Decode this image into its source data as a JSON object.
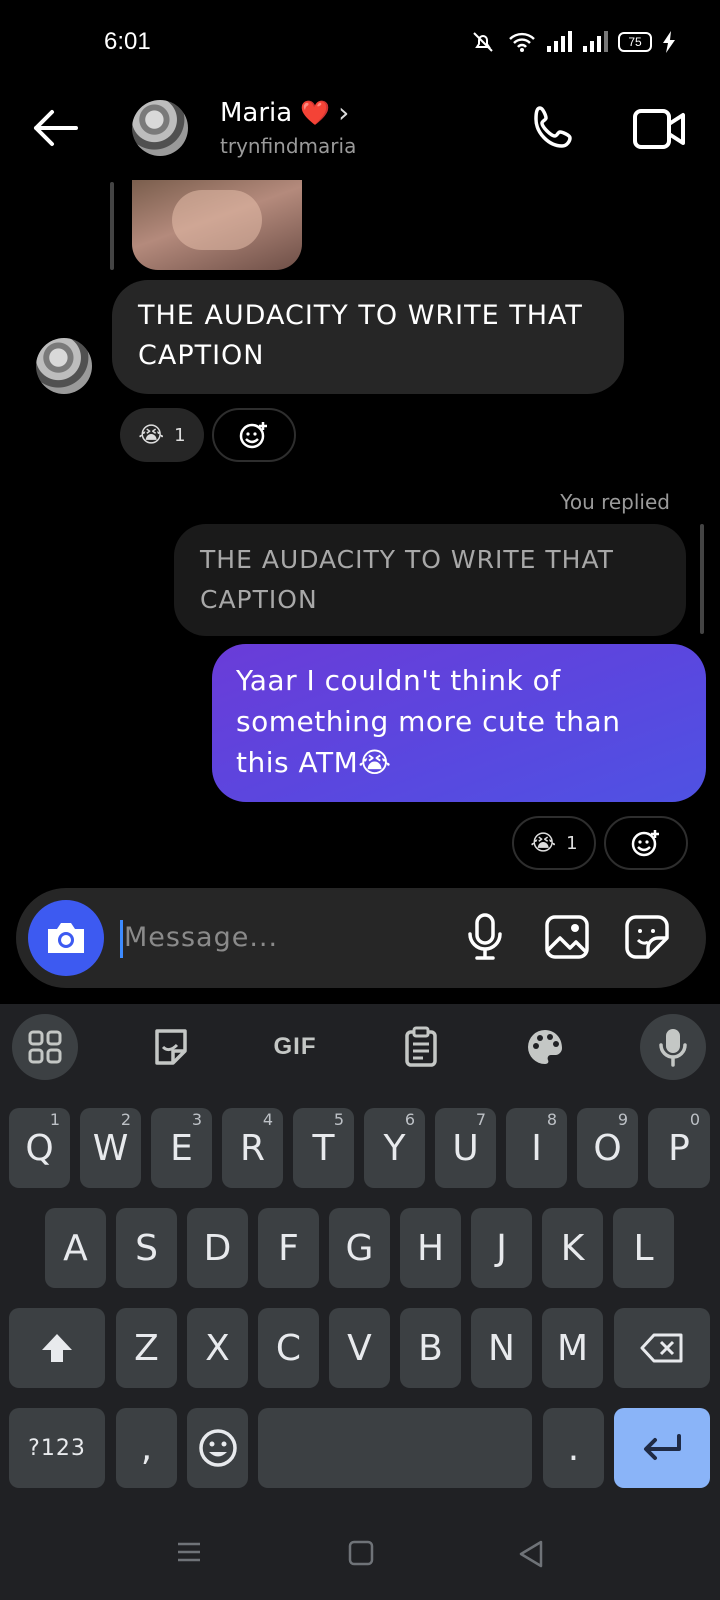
{
  "status_bar": {
    "time": "6:01",
    "battery": "75"
  },
  "header": {
    "name": "Maria",
    "name_emoji": "❤️",
    "chevron": "›",
    "username": "trynfindmaria"
  },
  "chat": {
    "incoming_message": "THE AUDACITY TO WRITE THAT CAPTION",
    "incoming_reaction": {
      "emoji": "😭",
      "count": "1"
    },
    "you_replied_label": "You replied",
    "replied_to_text": "THE AUDACITY TO WRITE THAT CAPTION",
    "outgoing_message": "Yaar I couldn't think of something more cute than this ATM😭",
    "outgoing_reaction": {
      "emoji": "😭",
      "count": "1"
    }
  },
  "composer": {
    "placeholder": "Message..."
  },
  "keyboard": {
    "toolbar": {
      "gif_label": "GIF"
    },
    "row1": [
      {
        "key": "Q",
        "hint": "1"
      },
      {
        "key": "W",
        "hint": "2"
      },
      {
        "key": "E",
        "hint": "3"
      },
      {
        "key": "R",
        "hint": "4"
      },
      {
        "key": "T",
        "hint": "5"
      },
      {
        "key": "Y",
        "hint": "6"
      },
      {
        "key": "U",
        "hint": "7"
      },
      {
        "key": "I",
        "hint": "8"
      },
      {
        "key": "O",
        "hint": "9"
      },
      {
        "key": "P",
        "hint": "0"
      }
    ],
    "row2": [
      "A",
      "S",
      "D",
      "F",
      "G",
      "H",
      "J",
      "K",
      "L"
    ],
    "row3": [
      "Z",
      "X",
      "C",
      "V",
      "B",
      "N",
      "M"
    ],
    "symbols_label": "?123",
    "comma": ",",
    "period": "."
  },
  "icons": {
    "back": "arrow-left-icon",
    "call": "phone-icon",
    "video": "video-camera-icon",
    "camera": "camera-icon",
    "mic": "microphone-icon",
    "gallery": "image-icon",
    "sticker": "sticker-icon",
    "add_reaction": "add-emoji-icon"
  },
  "colors": {
    "outgoing_bubble_start": "#6a3cd8",
    "outgoing_bubble_end": "#4f52e3",
    "camera_button": "#3d5af1",
    "enter_key": "#8ab4f8",
    "keyboard_bg": "#202124"
  }
}
